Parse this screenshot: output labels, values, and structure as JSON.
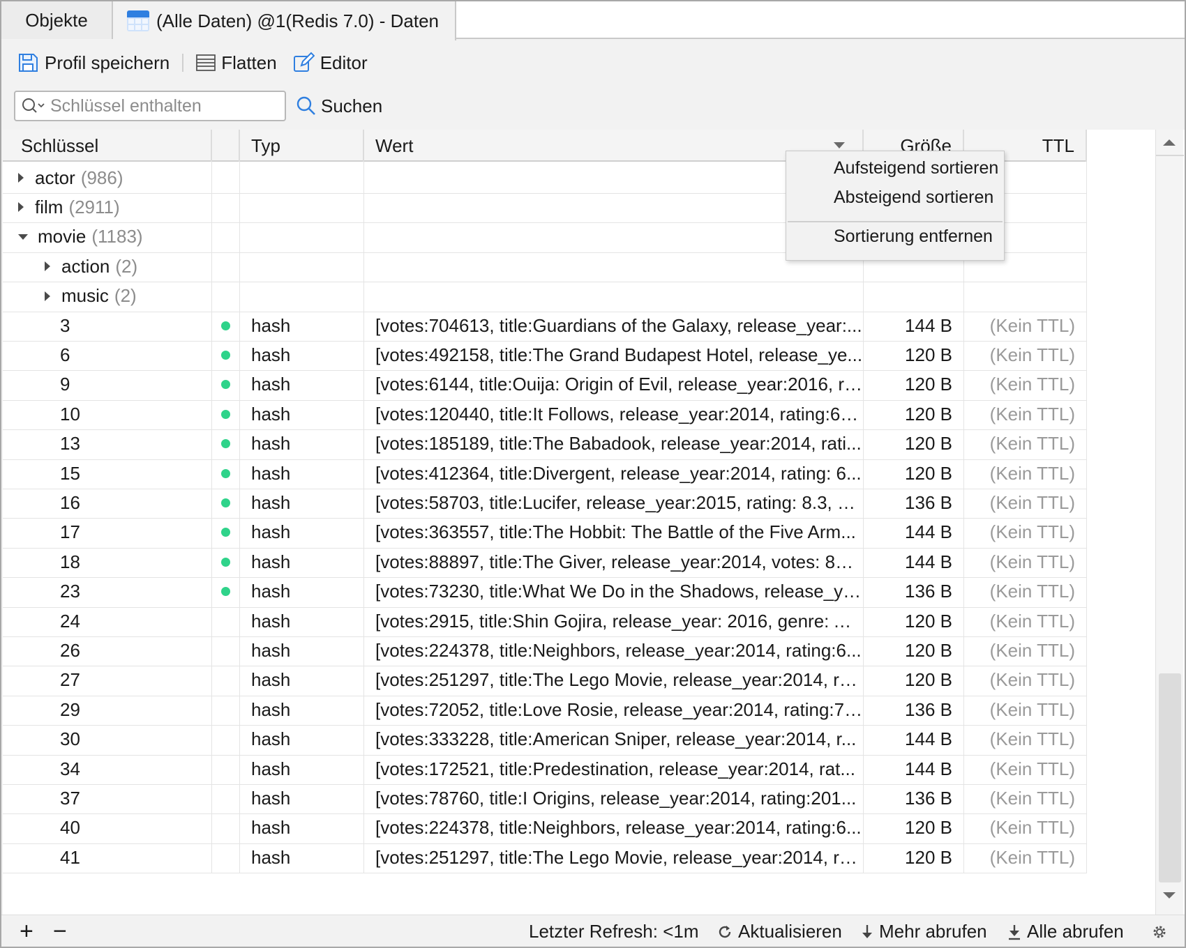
{
  "tabs": [
    {
      "label": "Objekte"
    },
    {
      "label": "(Alle Daten) @1(Redis 7.0) - Daten"
    }
  ],
  "toolbar": {
    "save_profile": "Profil speichern",
    "flatten": "Flatten",
    "editor": "Editor"
  },
  "search": {
    "placeholder": "Schlüssel enthalten",
    "button": "Suchen"
  },
  "columns": {
    "key": "Schlüssel",
    "type": "Typ",
    "value": "Wert",
    "size": "Größe",
    "ttl": "TTL"
  },
  "groups": [
    {
      "name": "actor",
      "count": "(986)",
      "expanded": false
    },
    {
      "name": "film",
      "count": "(2911)",
      "expanded": false
    },
    {
      "name": "movie",
      "count": "(1183)",
      "expanded": true
    },
    {
      "name": "action",
      "count": "(2)",
      "expanded": false
    },
    {
      "name": "music",
      "count": "(2)",
      "expanded": false
    }
  ],
  "rows": [
    {
      "key": "3",
      "dot": true,
      "type": "hash",
      "value": "[votes:704613, title:Guardians of the Galaxy, release_year:...",
      "size": "144 B",
      "ttl": "(Kein TTL)"
    },
    {
      "key": "6",
      "dot": true,
      "type": "hash",
      "value": "[votes:492158, title:The Grand Budapest Hotel, release_ye...",
      "size": "120 B",
      "ttl": "(Kein TTL)"
    },
    {
      "key": "9",
      "dot": true,
      "type": "hash",
      "value": "[votes:6144, title:Ouija: Origin of Evil, release_year:2016, ra...",
      "size": "120 B",
      "ttl": "(Kein TTL)"
    },
    {
      "key": "10",
      "dot": true,
      "type": "hash",
      "value": "[votes:120440, title:It Follows, release_year:2014, rating:6.9...",
      "size": "120 B",
      "ttl": "(Kein TTL)"
    },
    {
      "key": "13",
      "dot": true,
      "type": "hash",
      "value": "[votes:185189, title:The Babadook, release_year:2014, rati...",
      "size": "120 B",
      "ttl": "(Kein TTL)"
    },
    {
      "key": "15",
      "dot": true,
      "type": "hash",
      "value": "[votes:412364, title:Divergent, release_year:2014, rating: 6...",
      "size": "120 B",
      "ttl": "(Kein TTL)"
    },
    {
      "key": "16",
      "dot": true,
      "type": "hash",
      "value": "[votes:58703, title:Lucifer, release_year:2015, rating: 8.3, vo...",
      "size": "136 B",
      "ttl": "(Kein TTL)"
    },
    {
      "key": "17",
      "dot": true,
      "type": "hash",
      "value": "[votes:363557, title:The Hobbit: The Battle of the Five Arm...",
      "size": "144 B",
      "ttl": "(Kein TTL)"
    },
    {
      "key": "18",
      "dot": true,
      "type": "hash",
      "value": "[votes:88897, title:The Giver, release_year:2014, votes: 888...",
      "size": "144 B",
      "ttl": "(Kein TTL)"
    },
    {
      "key": "23",
      "dot": true,
      "type": "hash",
      "value": "[votes:73230, title:What We Do in the Shadows, release_ye...",
      "size": "136 B",
      "ttl": "(Kein TTL)"
    },
    {
      "key": "24",
      "dot": false,
      "type": "hash",
      "value": "[votes:2915, title:Shin Gojira, release_year: 2016, genre: Act...",
      "size": "120 B",
      "ttl": "(Kein TTL)"
    },
    {
      "key": "26",
      "dot": false,
      "type": "hash",
      "value": "[votes:224378, title:Neighbors, release_year:2014, rating:6...",
      "size": "120 B",
      "ttl": "(Kein TTL)"
    },
    {
      "key": "27",
      "dot": false,
      "type": "hash",
      "value": "[votes:251297, title:The Lego Movie, release_year:2014, rati...",
      "size": "120 B",
      "ttl": "(Kein TTL)"
    },
    {
      "key": "29",
      "dot": false,
      "type": "hash",
      "value": "[votes:72052, title:Love Rosie, release_year:2014, rating:7.2...",
      "size": "136 B",
      "ttl": "(Kein TTL)"
    },
    {
      "key": "30",
      "dot": false,
      "type": "hash",
      "value": "[votes:333228, title:American Sniper, release_year:2014, r...",
      "size": "144 B",
      "ttl": "(Kein TTL)"
    },
    {
      "key": "34",
      "dot": false,
      "type": "hash",
      "value": "[votes:172521, title:Predestination, release_year:2014, rat...",
      "size": "144 B",
      "ttl": "(Kein TTL)"
    },
    {
      "key": "37",
      "dot": false,
      "type": "hash",
      "value": "[votes:78760, title:I Origins, release_year:2014, rating:201...",
      "size": "136 B",
      "ttl": "(Kein TTL)"
    },
    {
      "key": "40",
      "dot": false,
      "type": "hash",
      "value": "[votes:224378, title:Neighbors, release_year:2014, rating:6...",
      "size": "120 B",
      "ttl": "(Kein TTL)"
    },
    {
      "key": "41",
      "dot": false,
      "type": "hash",
      "value": "[votes:251297, title:The Lego Movie, release_year:2014, rati...",
      "size": "120 B",
      "ttl": "(Kein TTL)"
    }
  ],
  "context_menu": {
    "sort_asc": "Aufsteigend sortieren",
    "sort_desc": "Absteigend sortieren",
    "remove_sort": "Sortierung entfernen"
  },
  "statusbar": {
    "add": "+",
    "remove": "−",
    "last_refresh": "Letzter Refresh: <1m",
    "refresh": "Aktualisieren",
    "fetch_more": "Mehr abrufen",
    "fetch_all": "Alle abrufen"
  },
  "colors": {
    "dot": "#2fd38a",
    "accent": "#2f7fe0"
  }
}
